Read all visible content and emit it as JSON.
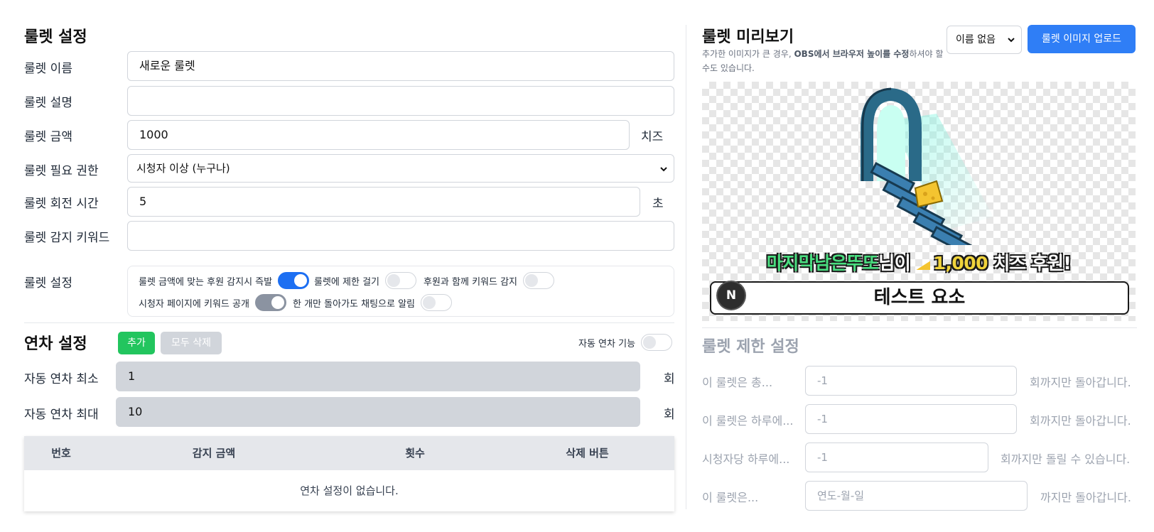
{
  "roulette": {
    "title": "룰렛 설정",
    "name_label": "룰렛 이름",
    "name_value": "새로운 룰렛",
    "desc_label": "룰렛 설명",
    "desc_value": "",
    "price_label": "룰렛 금액",
    "price_value": "1000",
    "price_unit": "치즈",
    "permission_label": "룰렛 필요 권한",
    "permission_value": "시청자 이상 (누구나)",
    "spin_time_label": "룰렛 회전 시간",
    "spin_time_value": "5",
    "spin_time_unit": "초",
    "keyword_label": "룰렛 감지 키워드",
    "keyword_value": "",
    "settings_label": "룰렛 설정",
    "toggles": [
      {
        "label": "룰렛 금액에 맞는 후원 감지시 즉발",
        "state": "on"
      },
      {
        "label": "룰렛에 제한 걸기",
        "state": "off"
      },
      {
        "label": "후원과 함께 키워드 감지",
        "state": "off"
      },
      {
        "label": "시청자 페이지에 키워드 공개",
        "state": "disabled-on"
      },
      {
        "label": "한 개만 돌아가도 채팅으로 알림",
        "state": "off"
      }
    ]
  },
  "combo": {
    "title": "연차 설정",
    "add_label": "추가",
    "delete_all_label": "모두 삭제",
    "auto_label": "자동 연차 기능",
    "auto_state": "off",
    "min_label": "자동 연차 최소",
    "min_value": "1",
    "max_label": "자동 연차 최대",
    "max_value": "10",
    "count_unit": "회",
    "table_headers": [
      "번호",
      "감지 금액",
      "횟수",
      "삭제 버튼"
    ],
    "empty_text": "연차 설정이 없습니다."
  },
  "preview": {
    "title": "룰렛 미리보기",
    "hint_before": "추가한 이미지가 큰 경우, ",
    "hint_bold": "OBS에서 브라우저 높이를 수정",
    "hint_after": "하셔야 할 수도 있습니다.",
    "name_select": "이름 없음",
    "upload_label": "룰렛 이미지 업로드",
    "donation_nick": "마지막남은뚜또",
    "donation_mid": "님이 ",
    "donation_amount": "1,000",
    "donation_tail": " 치즈 후원!",
    "test_label": "테스트 요소",
    "avatar_letter": "N"
  },
  "limits": {
    "title": "룰렛 제한 설정",
    "rows": [
      {
        "label": "이 룰렛은 총...",
        "value": "-1",
        "suffix": "회까지만 돌아갑니다."
      },
      {
        "label": "이 룰렛은 하루에...",
        "value": "-1",
        "suffix": "회까지만 돌아갑니다."
      },
      {
        "label": "시청자당 하루에...",
        "value": "-1",
        "suffix": "회까지만 돌릴 수 있습니다."
      },
      {
        "label": "이 룰렛은...",
        "value": "연도-월-일",
        "suffix": "까지만 돌아갑니다."
      }
    ]
  },
  "colors": {
    "accent": "#2f7ef6",
    "toggle_on": "#1d6ff2",
    "add_button": "#22c55e",
    "nick": "#4ade80",
    "amount": "#f0d33b"
  }
}
